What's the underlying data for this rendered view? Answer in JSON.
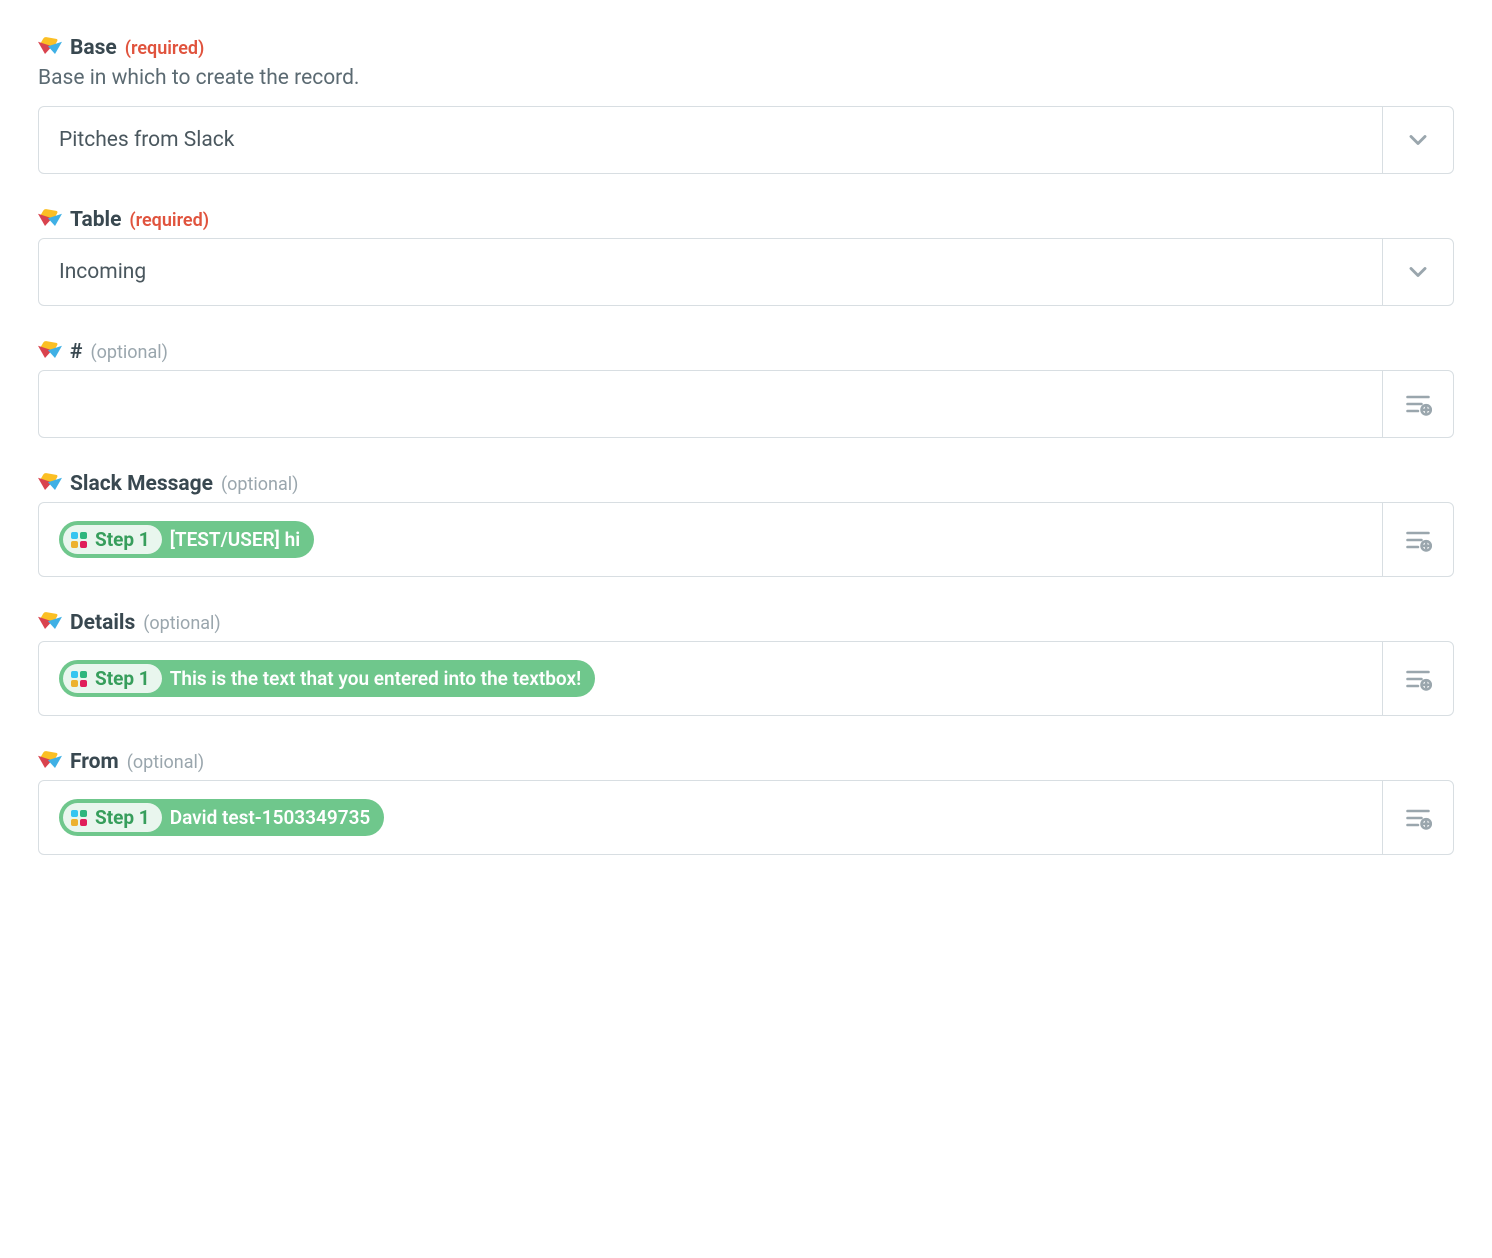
{
  "required_label": "(required)",
  "optional_label": "(optional)",
  "fields": {
    "base": {
      "label": "Base",
      "help": "Base in which to create the record.",
      "value": "Pitches from Slack"
    },
    "table": {
      "label": "Table",
      "value": "Incoming"
    },
    "hash": {
      "label": "#"
    },
    "slack_message": {
      "label": "Slack Message",
      "pill_step": "Step 1",
      "pill_value": "[TEST/USER] hi"
    },
    "details": {
      "label": "Details",
      "pill_step": "Step 1",
      "pill_value": "This is the text that you entered into the textbox!"
    },
    "from": {
      "label": "From",
      "pill_step": "Step 1",
      "pill_value": "David test-1503349735"
    }
  }
}
